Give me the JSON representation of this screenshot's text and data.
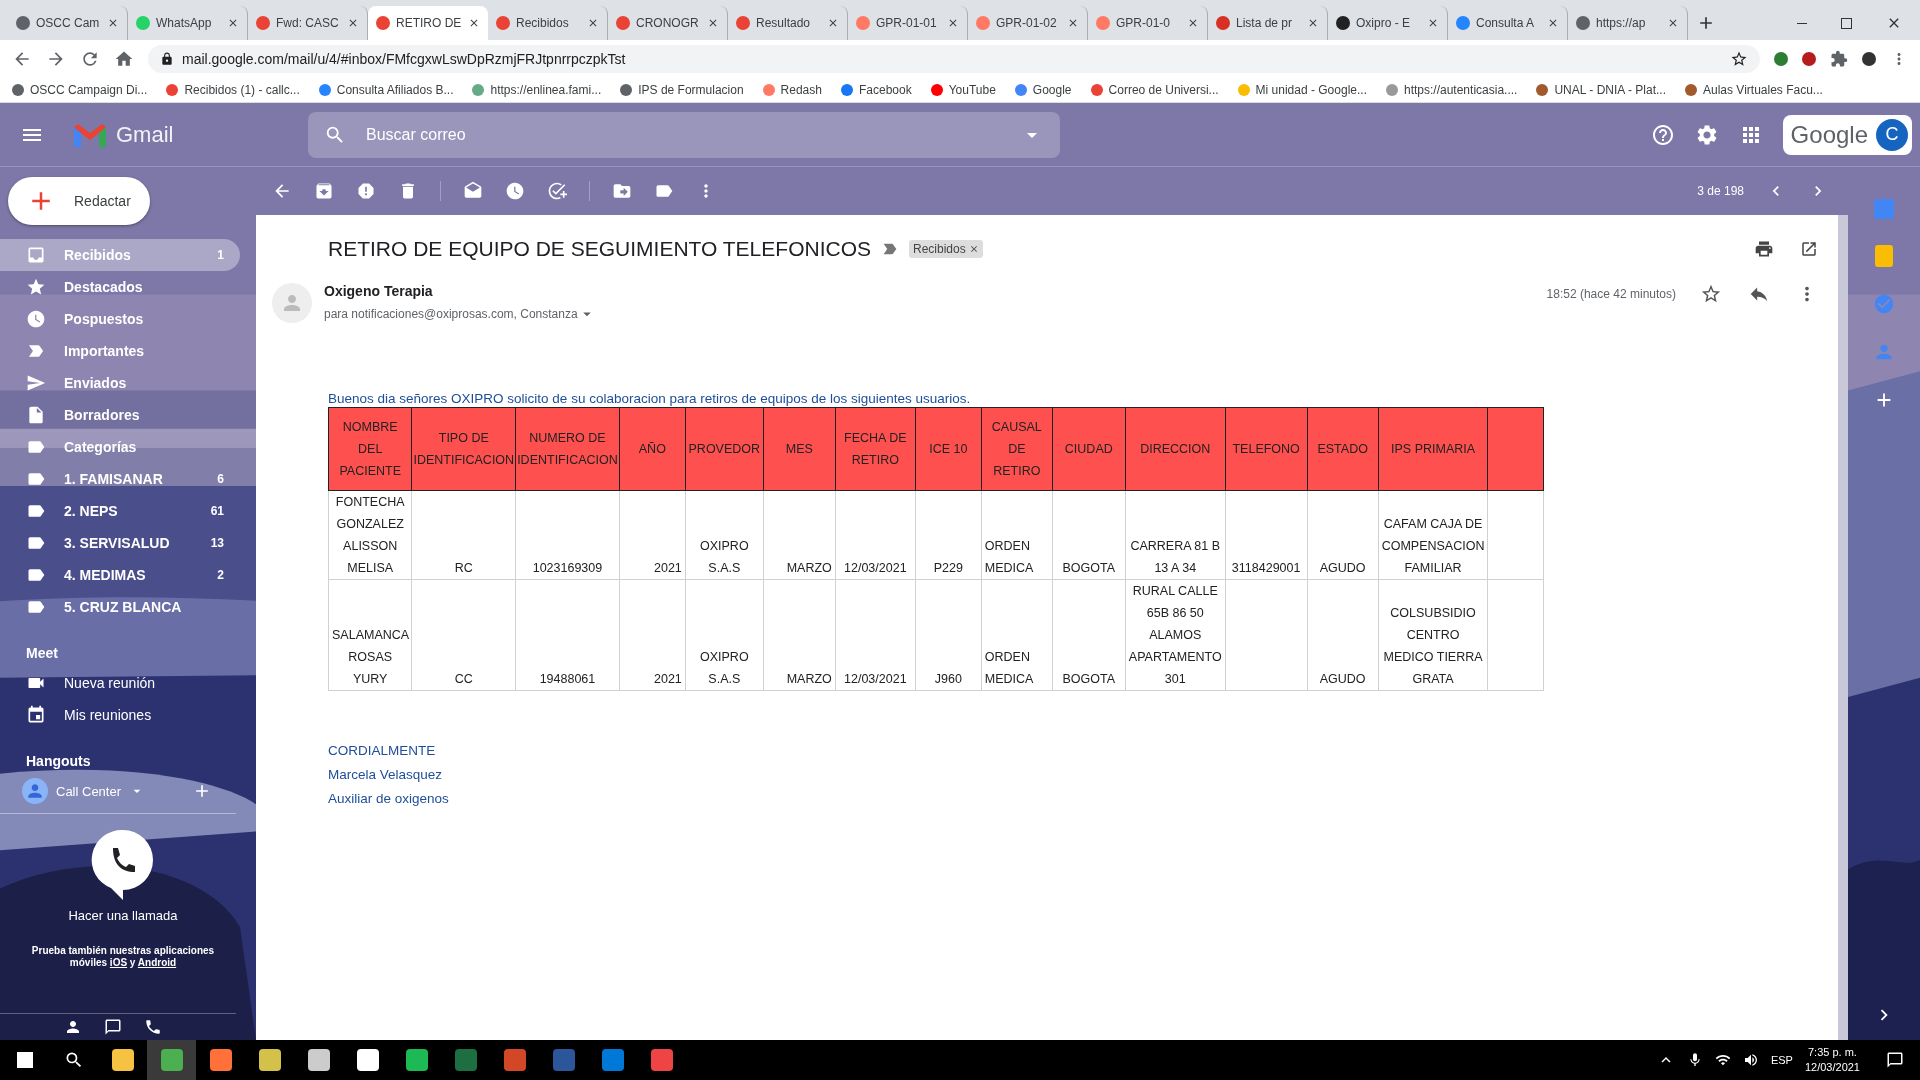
{
  "browser": {
    "tabs": [
      {
        "title": "OSCC Cam",
        "kind": "site",
        "selected": false
      },
      {
        "title": "WhatsApp",
        "kind": "whatsapp",
        "selected": false
      },
      {
        "title": "Fwd: CASC",
        "kind": "gmail",
        "selected": false
      },
      {
        "title": "RETIRO DE",
        "kind": "gmail",
        "selected": true
      },
      {
        "title": "Recibidos",
        "kind": "gmail",
        "selected": false
      },
      {
        "title": "CRONOGR",
        "kind": "gmail",
        "selected": false
      },
      {
        "title": "Resultado",
        "kind": "gmail",
        "selected": false
      },
      {
        "title": "GPR-01-01",
        "kind": "redash",
        "selected": false
      },
      {
        "title": "GPR-01-02",
        "kind": "redash",
        "selected": false
      },
      {
        "title": "GPR-01-0",
        "kind": "redash",
        "selected": false
      },
      {
        "title": "Lista de pr",
        "kind": "pin",
        "selected": false
      },
      {
        "title": "Oxipro - E",
        "kind": "dark",
        "selected": false
      },
      {
        "title": "Consulta A",
        "kind": "atlassian",
        "selected": false
      },
      {
        "title": "https://ap",
        "kind": "site",
        "selected": false
      }
    ],
    "url": "mail.google.com/mail/u/4/#inbox/FMfcgxwLswDpRzmjFRJtpnrrpczpkTst",
    "bookmarks": [
      {
        "label": "OSCC Campaign Di...",
        "kind": "site"
      },
      {
        "label": "Recibidos (1) - callc...",
        "kind": "gmail"
      },
      {
        "label": "Consulta Afiliados B...",
        "kind": "atlassian"
      },
      {
        "label": "https://enlinea.fami...",
        "kind": "plant"
      },
      {
        "label": "IPS de Formulacion",
        "kind": "site"
      },
      {
        "label": "Redash",
        "kind": "redash"
      },
      {
        "label": "Facebook",
        "kind": "facebook"
      },
      {
        "label": "YouTube",
        "kind": "youtube"
      },
      {
        "label": "Google",
        "kind": "google"
      },
      {
        "label": "Correo de Universi...",
        "kind": "gmail"
      },
      {
        "label": "Mi unidad - Google...",
        "kind": "drive"
      },
      {
        "label": "https://autenticasia....",
        "kind": "lock"
      },
      {
        "label": "UNAL - DNIA - Plat...",
        "kind": "unal"
      },
      {
        "label": "Aulas Virtuales Facu...",
        "kind": "unal"
      }
    ]
  },
  "gmail": {
    "app_name": "Gmail",
    "search": {
      "placeholder": "Buscar correo"
    },
    "account": {
      "brand": "Google",
      "initial": "C"
    },
    "compose": "Redactar",
    "nav": [
      {
        "label": "Recibidos",
        "count": "1",
        "selected": true
      },
      {
        "label": "Destacados",
        "selected": false
      },
      {
        "label": "Pospuestos",
        "selected": false
      },
      {
        "label": "Importantes",
        "selected": false
      },
      {
        "label": "Enviados",
        "selected": false
      },
      {
        "label": "Borradores",
        "selected": false
      },
      {
        "label": "Categorías",
        "selected": false
      },
      {
        "label": "1. FAMISANAR",
        "count": "6",
        "selected": false
      },
      {
        "label": "2. NEPS",
        "count": "61",
        "selected": false
      },
      {
        "label": "3. SERVISALUD",
        "count": "13",
        "selected": false
      },
      {
        "label": "4. MEDIMAS",
        "count": "2",
        "selected": false
      },
      {
        "label": "5. CRUZ BLANCA",
        "selected": false
      }
    ],
    "meet": {
      "heading": "Meet",
      "items": [
        "Nueva reunión",
        "Mis reuniones"
      ]
    },
    "hangouts": {
      "heading": "Hangouts",
      "user": "Call Center",
      "call": "Hacer una llamada",
      "promo": {
        "text": "Prueba también nuestras aplicaciones móviles ",
        "link_1": "iOS",
        "joiner": " y ",
        "link_2": "Android"
      }
    },
    "pager": "3 de 198"
  },
  "email": {
    "subject": "RETIRO DE EQUIPO DE SEGUIMIENTO TELEFONICOS",
    "label": "Recibidos",
    "sender": "Oxigeno Terapia",
    "recipients": "para notificaciones@oxiprosas.com, Constanza",
    "time": "18:52 (hace 42 minutos)",
    "intro": "Buenos dia señores OXIPRO  solicito de su colaboracion para retiros de equipos de los siguientes usuarios.",
    "table": {
      "columns": [
        "NOMBRE DEL PACIENTE",
        "TIPO DE IDENTIFICACION",
        "NUMERO DE IDENTIFICACION",
        "AÑO",
        "PROVEDOR",
        "MES",
        "FECHA DE RETIRO",
        "ICE 10",
        "CAUSAL DE RETIRO",
        "CIUDAD",
        "DIRECCION",
        "TELEFONO",
        "ESTADO",
        "IPS PRIMARIA"
      ],
      "rows": [
        [
          "FONTECHA GONZALEZ ALISSON MELISA",
          "RC",
          "1023169309",
          "2021",
          "OXIPRO S.A.S",
          "MARZO",
          "12/03/2021",
          "P229",
          "ORDEN MEDICA",
          "BOGOTA",
          "CARRERA 81 B 13 A 34",
          "3118429001",
          "AGUDO",
          "CAFAM CAJA DE COMPENSACION FAMILIAR"
        ],
        [
          "SALAMANCA ROSAS YURY",
          "CC",
          "19488061",
          "2021",
          "OXIPRO S.A.S",
          "MARZO",
          "12/03/2021",
          "J960",
          "ORDEN MEDICA",
          "BOGOTA",
          "RURAL CALLE 65B 86 50 ALAMOS APARTAMENTO 301",
          "",
          "AGUDO",
          "COLSUBSIDIO CENTRO MEDICO TIERRA GRATA"
        ]
      ]
    },
    "signature": [
      "CORDIALMENTE",
      "Marcela Velasquez",
      "Auxiliar de oxigenos"
    ]
  },
  "taskbar": {
    "language": "ESP",
    "time": "7:35 p. m.",
    "date": "12/03/2021"
  }
}
